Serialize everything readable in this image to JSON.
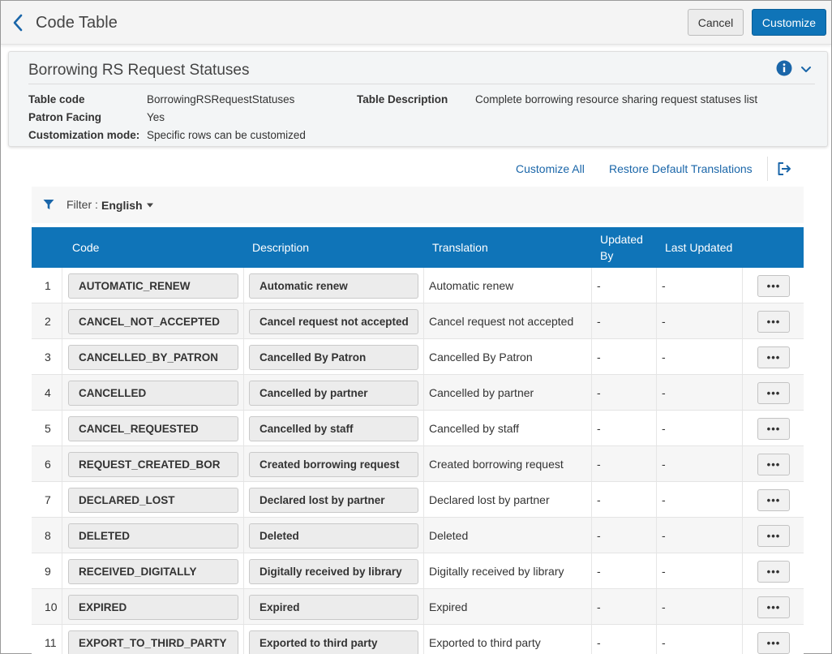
{
  "header": {
    "title": "Code Table",
    "cancel_label": "Cancel",
    "customize_label": "Customize"
  },
  "summary": {
    "title": "Borrowing RS Request Statuses",
    "table_code_label": "Table code",
    "table_code_value": "BorrowingRSRequestStatuses",
    "patron_facing_label": "Patron Facing",
    "patron_facing_value": "Yes",
    "customization_mode_label": "Customization mode:",
    "customization_mode_value": "Specific rows can be customized",
    "table_description_label": "Table Description",
    "table_description_value": "Complete borrowing resource sharing request statuses list"
  },
  "actions": {
    "customize_all": "Customize All",
    "restore_default": "Restore Default Translations"
  },
  "filter": {
    "label": "Filter :",
    "value": "English"
  },
  "table": {
    "headers": {
      "code": "Code",
      "description": "Description",
      "translation": "Translation",
      "updated_by_line1": "Updated",
      "updated_by_line2": "By",
      "last_updated": "Last Updated"
    },
    "rows": [
      {
        "num": "1",
        "code": "AUTOMATIC_RENEW",
        "description": "Automatic renew",
        "translation": "Automatic renew",
        "updated_by": "-",
        "last_updated": "-"
      },
      {
        "num": "2",
        "code": "CANCEL_NOT_ACCEPTED",
        "description": "Cancel request not accepted",
        "translation": "Cancel request not accepted",
        "updated_by": "-",
        "last_updated": "-"
      },
      {
        "num": "3",
        "code": "CANCELLED_BY_PATRON",
        "description": "Cancelled By Patron",
        "translation": "Cancelled By Patron",
        "updated_by": "-",
        "last_updated": "-"
      },
      {
        "num": "4",
        "code": "CANCELLED",
        "description": "Cancelled by partner",
        "translation": "Cancelled by partner",
        "updated_by": "-",
        "last_updated": "-"
      },
      {
        "num": "5",
        "code": "CANCEL_REQUESTED",
        "description": "Cancelled by staff",
        "translation": "Cancelled by staff",
        "updated_by": "-",
        "last_updated": "-"
      },
      {
        "num": "6",
        "code": "REQUEST_CREATED_BOR",
        "description": "Created borrowing request",
        "translation": "Created borrowing request",
        "updated_by": "-",
        "last_updated": "-"
      },
      {
        "num": "7",
        "code": "DECLARED_LOST",
        "description": "Declared lost by partner",
        "translation": "Declared lost by partner",
        "updated_by": "-",
        "last_updated": "-"
      },
      {
        "num": "8",
        "code": "DELETED",
        "description": "Deleted",
        "translation": "Deleted",
        "updated_by": "-",
        "last_updated": "-"
      },
      {
        "num": "9",
        "code": "RECEIVED_DIGITALLY",
        "description": "Digitally received by library",
        "translation": "Digitally received by library",
        "updated_by": "-",
        "last_updated": "-"
      },
      {
        "num": "10",
        "code": "EXPIRED",
        "description": "Expired",
        "translation": "Expired",
        "updated_by": "-",
        "last_updated": "-"
      },
      {
        "num": "11",
        "code": "EXPORT_TO_THIRD_PARTY",
        "description": "Exported to third party",
        "translation": "Exported to third party",
        "updated_by": "-",
        "last_updated": "-"
      }
    ],
    "row_action_label": "•••"
  },
  "icons": {
    "back": "chevron-left-icon",
    "info": "info-icon",
    "collapse": "chevron-down-icon",
    "export": "export-icon",
    "filter": "filter-icon",
    "caret": "caret-down-icon"
  },
  "colors": {
    "primary": "#0f74b8",
    "link": "#1a66a9"
  }
}
